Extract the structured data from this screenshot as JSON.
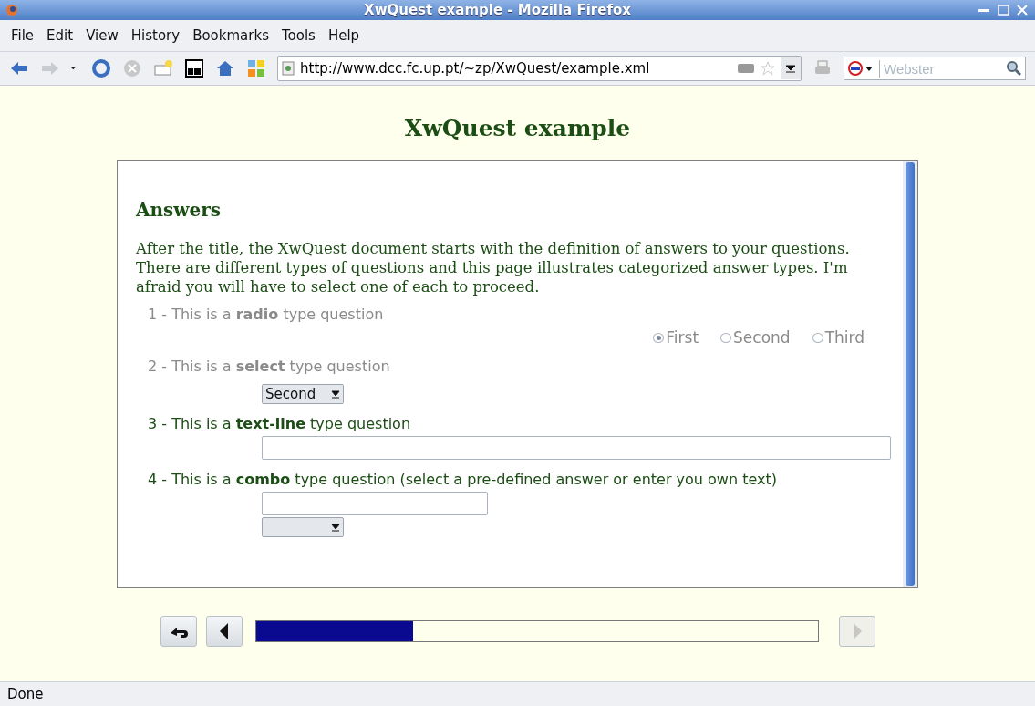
{
  "window": {
    "title": "XwQuest example - Mozilla Firefox"
  },
  "menu": [
    "File",
    "Edit",
    "View",
    "History",
    "Bookmarks",
    "Tools",
    "Help"
  ],
  "toolbar": {
    "address": "http://www.dcc.fc.up.pt/~zp/XwQuest/example.xml",
    "search": {
      "placeholder": "Webster"
    }
  },
  "page": {
    "title": "XwQuest example",
    "section": "Answers",
    "intro": "After the title, the XwQuest document starts with the definition of answers to your questions. There are different types of questions and this page illustrates categorized answer types. I'm afraid you will have to select one of each to proceed.",
    "questions": [
      {
        "kind": "radio",
        "label": "1 - This is a **radio** type question",
        "disabled": true,
        "options": [
          {
            "label": "First",
            "selected": true
          },
          {
            "label": "Second",
            "selected": false
          },
          {
            "label": "Third",
            "selected": false
          }
        ]
      },
      {
        "kind": "select",
        "label": "2 - This is a **select** type question",
        "disabled": true,
        "value": "Second"
      },
      {
        "kind": "text",
        "label": "3 - This is a **text-line** type question",
        "disabled": false
      },
      {
        "kind": "combo",
        "label": "4 - This is a **combo** type question (select a pre-defined answer or enter you own text)",
        "disabled": false
      }
    ]
  },
  "navigation": {
    "progress": {
      "level": 0.28
    },
    "next_disabled": true
  },
  "status_bar": "Done"
}
